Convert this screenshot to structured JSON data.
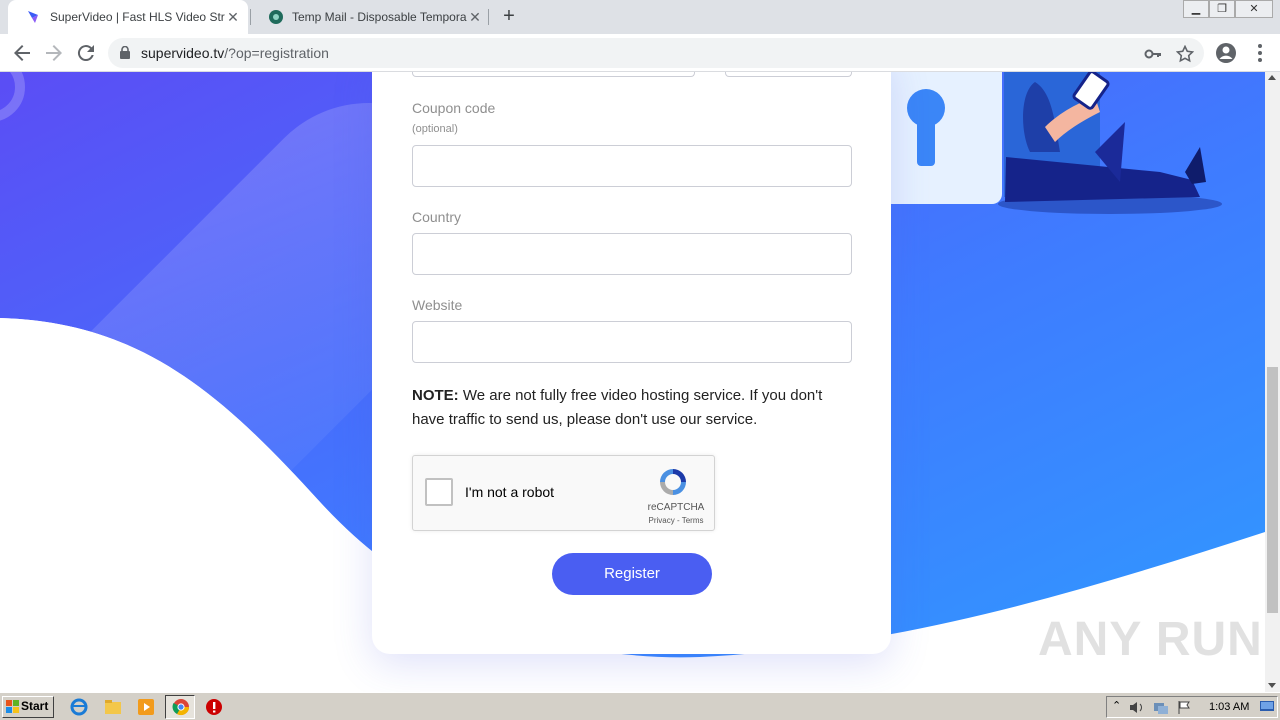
{
  "browser": {
    "tabs": [
      {
        "title": "SuperVideo | Fast HLS Video Streami",
        "active": true
      },
      {
        "title": "Temp Mail - Disposable Temporary E",
        "active": false
      }
    ],
    "url": {
      "host": "supervideo.tv",
      "path": "/?op=registration"
    }
  },
  "form": {
    "coupon_label": "Coupon code",
    "coupon_sub": "(optional)",
    "coupon_value": "",
    "country_label": "Country",
    "country_value": "",
    "website_label": "Website",
    "website_value": "",
    "note_bold": "NOTE:",
    "note_text": " We are not fully free video hosting service. If you don't have traffic to send us, please don't use our service.",
    "captcha_label": "I'm not a robot",
    "captcha_brand": "reCAPTCHA",
    "captcha_links": "Privacy - Terms",
    "register_label": "Register"
  },
  "watermark": "ANY RUN",
  "taskbar": {
    "start_label": "Start",
    "clock": "1:03 AM"
  },
  "colors": {
    "accent": "#4a5ef2",
    "hero_gradient_start": "#5b4df5",
    "hero_gradient_end": "#2f9bff"
  }
}
